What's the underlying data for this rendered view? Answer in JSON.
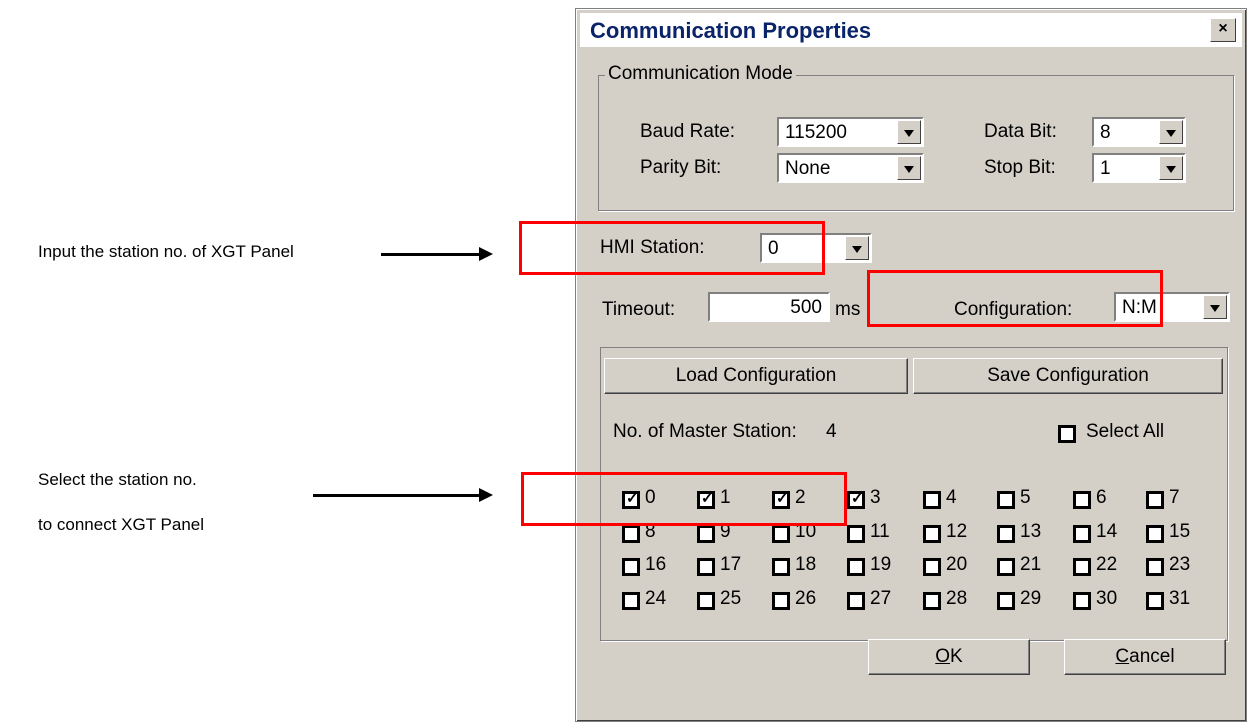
{
  "annotations": {
    "station_input_note": "Input the station no. of XGT Panel",
    "select_note_line1": "Select the station no.",
    "select_note_line2": "to connect XGT Panel"
  },
  "dialog": {
    "title": "Communication Properties",
    "close_glyph": "×",
    "comm_mode": {
      "legend": "Communication Mode",
      "baud_rate_label": "Baud Rate:",
      "baud_rate_value": "115200",
      "data_bit_label": "Data Bit:",
      "data_bit_value": "8",
      "parity_bit_label": "Parity Bit:",
      "parity_bit_value": "None",
      "stop_bit_label": "Stop Bit:",
      "stop_bit_value": "1"
    },
    "hmi_station_label": "HMI Station:",
    "hmi_station_value": "0",
    "timeout_label": "Timeout:",
    "timeout_value": "500",
    "timeout_unit": "ms",
    "configuration_label": "Configuration:",
    "configuration_value": "N:M",
    "load_config_button": "Load Configuration",
    "save_config_button": "Save Configuration",
    "master_station_label": "No. of Master Station:",
    "master_station_count": "4",
    "select_all_label": "Select All",
    "stations": [
      {
        "label": "0",
        "checked": true
      },
      {
        "label": "1",
        "checked": true
      },
      {
        "label": "2",
        "checked": true
      },
      {
        "label": "3",
        "checked": true
      },
      {
        "label": "4",
        "checked": false
      },
      {
        "label": "5",
        "checked": false
      },
      {
        "label": "6",
        "checked": false
      },
      {
        "label": "7",
        "checked": false
      },
      {
        "label": "8",
        "checked": false
      },
      {
        "label": "9",
        "checked": false
      },
      {
        "label": "10",
        "checked": false
      },
      {
        "label": "11",
        "checked": false
      },
      {
        "label": "12",
        "checked": false
      },
      {
        "label": "13",
        "checked": false
      },
      {
        "label": "14",
        "checked": false
      },
      {
        "label": "15",
        "checked": false
      },
      {
        "label": "16",
        "checked": false
      },
      {
        "label": "17",
        "checked": false
      },
      {
        "label": "18",
        "checked": false
      },
      {
        "label": "19",
        "checked": false
      },
      {
        "label": "20",
        "checked": false
      },
      {
        "label": "21",
        "checked": false
      },
      {
        "label": "22",
        "checked": false
      },
      {
        "label": "23",
        "checked": false
      },
      {
        "label": "24",
        "checked": false
      },
      {
        "label": "25",
        "checked": false
      },
      {
        "label": "26",
        "checked": false
      },
      {
        "label": "27",
        "checked": false
      },
      {
        "label": "28",
        "checked": false
      },
      {
        "label": "29",
        "checked": false
      },
      {
        "label": "30",
        "checked": false
      },
      {
        "label": "31",
        "checked": false
      }
    ],
    "ok_button_mnemonic": "O",
    "ok_button_rest": "K",
    "cancel_button_mnemonic": "C",
    "cancel_button_rest": "ancel"
  },
  "colors": {
    "highlight_box": "#ff0000",
    "title_text": "#0a246a",
    "dialog_bg": "#d4d0c8"
  }
}
